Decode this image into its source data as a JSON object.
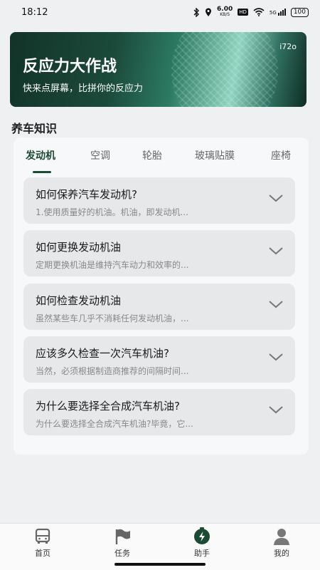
{
  "status_bar": {
    "time": "18:12",
    "speed_value": "6.00",
    "speed_unit": "KB/S",
    "hd": "HD",
    "network": "5G",
    "battery": "100",
    "icons": [
      "bluetooth-icon",
      "location-icon",
      "wifi-icon",
      "signal-icon",
      "battery-icon"
    ]
  },
  "banner": {
    "title": "反应力大作战",
    "subtitle": "快来点屏幕，比拼你的反应力",
    "tag": "i72o"
  },
  "section": {
    "title": "养车知识"
  },
  "tabs": [
    {
      "label": "发动机",
      "active": true
    },
    {
      "label": "空调",
      "active": false
    },
    {
      "label": "轮胎",
      "active": false
    },
    {
      "label": "玻璃贴膜",
      "active": false
    },
    {
      "label": "座椅",
      "active": false
    }
  ],
  "faqs": [
    {
      "question": "如何保养汽车发动机?",
      "preview": "1.使用质量好的机油。机油，即发动机..."
    },
    {
      "question": "如何更换发动机油",
      "preview": "定期更换机油是维持汽车动力和效率的..."
    },
    {
      "question": "如何检查发动机油",
      "preview": "虽然某些车几乎不消耗任何发动机油，..."
    },
    {
      "question": "应该多久检查一次汽车机油?",
      "preview": "当然，必须根据制造商推荐的间隔时间..."
    },
    {
      "question": "为什么要选择全合成汽车机油?",
      "preview": "为什么要选择全合成汽车机油?毕竟，它..."
    }
  ],
  "bottom_nav": [
    {
      "label": "首页",
      "icon": "bus-icon",
      "active": false
    },
    {
      "label": "任务",
      "icon": "flag-icon",
      "active": false
    },
    {
      "label": "助手",
      "icon": "lightning-icon",
      "active": true
    },
    {
      "label": "我的",
      "icon": "person-icon",
      "active": false
    }
  ],
  "colors": {
    "accent": "#1d4a34",
    "card_bg": "#f7f8f9",
    "item_bg": "#e6e8ea",
    "page_bg": "#eef0f2"
  }
}
